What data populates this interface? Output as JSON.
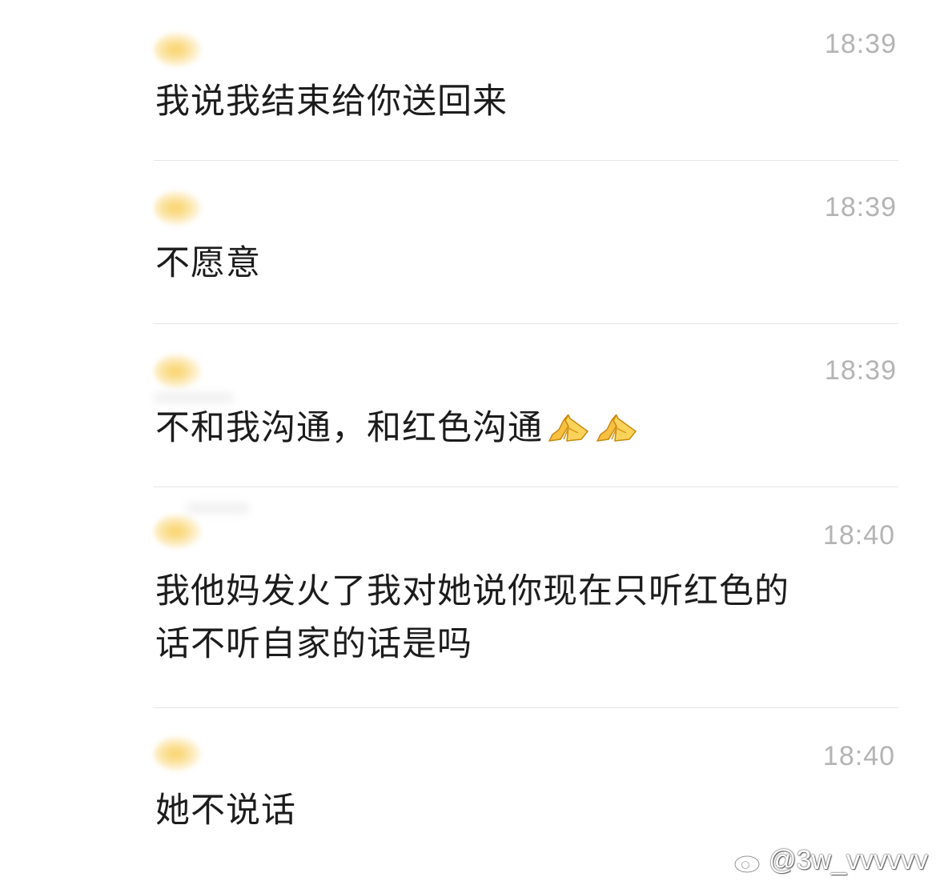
{
  "messages": [
    {
      "time": "18:39",
      "text": "我说我结束给你送回来"
    },
    {
      "time": "18:39",
      "text": "不愿意"
    },
    {
      "time": "18:39",
      "text": "不和我沟通，和红色沟通",
      "emoji": "folded-hands-icon"
    },
    {
      "time": "18:40",
      "text": "我他妈发火了我对她说你现在只听红色的\n话不听自家的话是吗"
    },
    {
      "time": "18:40",
      "text": "她不说话"
    }
  ],
  "watermark": {
    "handle": "@3w_vvvvvv",
    "icon": "weibo-logo-icon"
  },
  "colors": {
    "timestamp": "#b4b4b4",
    "divider": "#e6e6e6",
    "avatar": "#f9d36a"
  }
}
